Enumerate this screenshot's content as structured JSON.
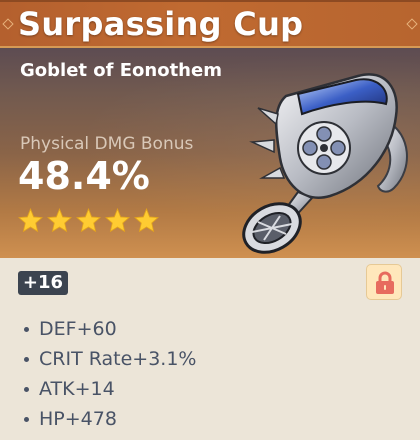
{
  "artifact": {
    "name": "Surpassing Cup",
    "slot_type": "Goblet of Eonothem",
    "main_stat": {
      "name": "Physical DMG Bonus",
      "value": "48.4%"
    },
    "rarity_stars": 5,
    "level": "+16",
    "locked": true,
    "substats": [
      {
        "label": "DEF+60"
      },
      {
        "label": "CRIT Rate+3.1%"
      },
      {
        "label": "ATK+14"
      },
      {
        "label": "HP+478"
      }
    ]
  },
  "colors": {
    "header_brown": "#b4602e",
    "star_gold": "#ffcc32",
    "lock_red": "#e76b5e",
    "text_muted": "#495366"
  },
  "icons": {
    "lock": "lock-icon",
    "star": "star-icon",
    "artifact": "goblet-artifact-image"
  }
}
